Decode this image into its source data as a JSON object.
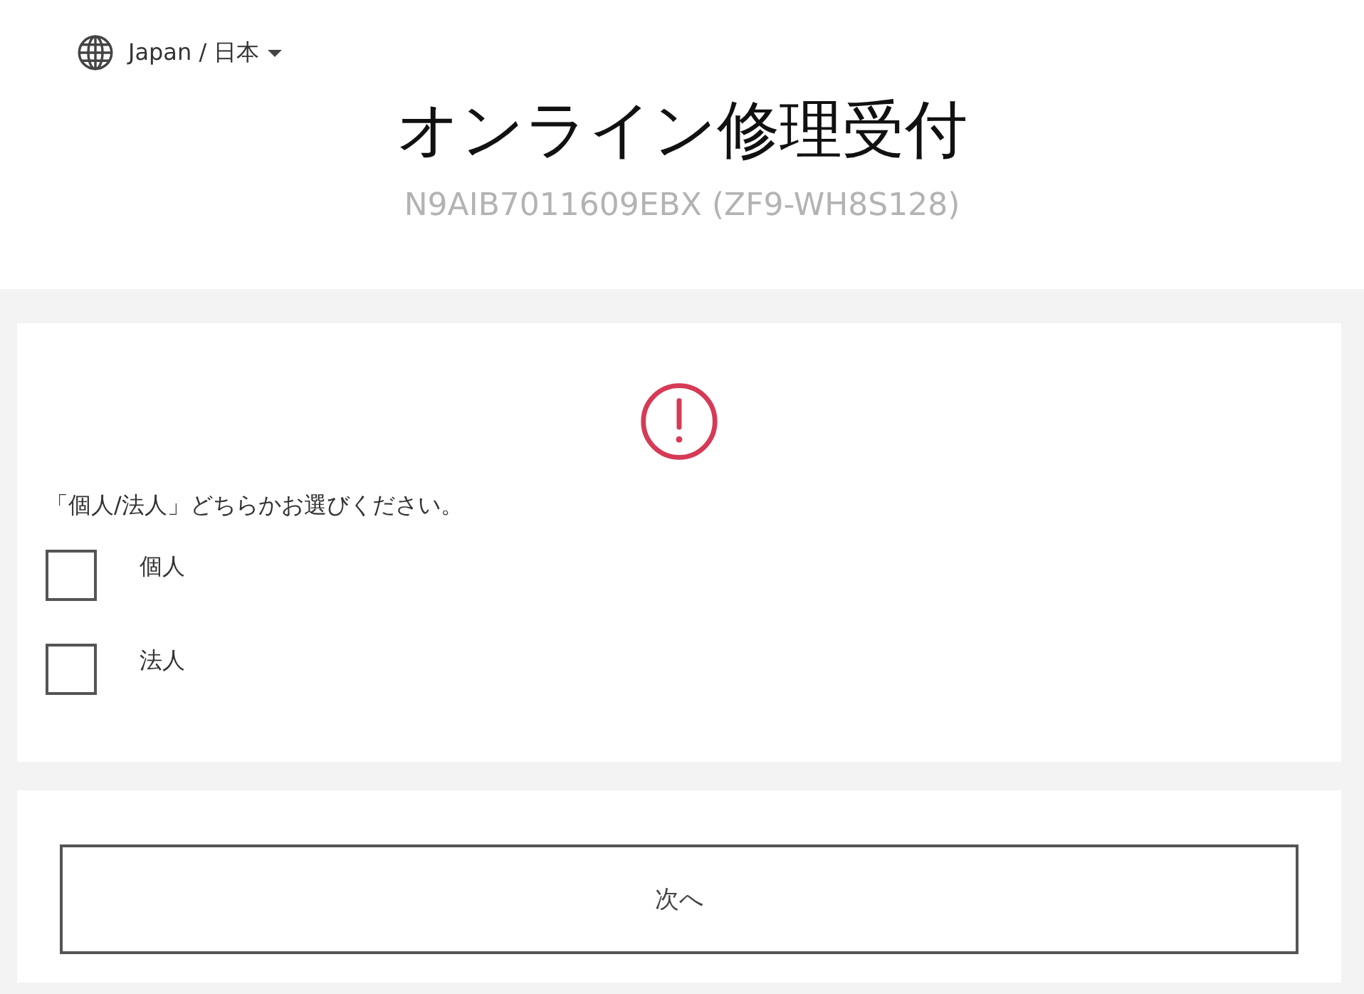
{
  "region_selector": {
    "label": "Japan / 日本"
  },
  "title": "オンライン修理受付",
  "serial": "N9AIB7011609EBX (ZF9-WH8S128)",
  "question": {
    "prompt": "「個人/法人」どちらかお選びください。",
    "options": [
      {
        "label": "個人",
        "checked": false
      },
      {
        "label": "法人",
        "checked": false
      }
    ]
  },
  "next_button": "次へ"
}
